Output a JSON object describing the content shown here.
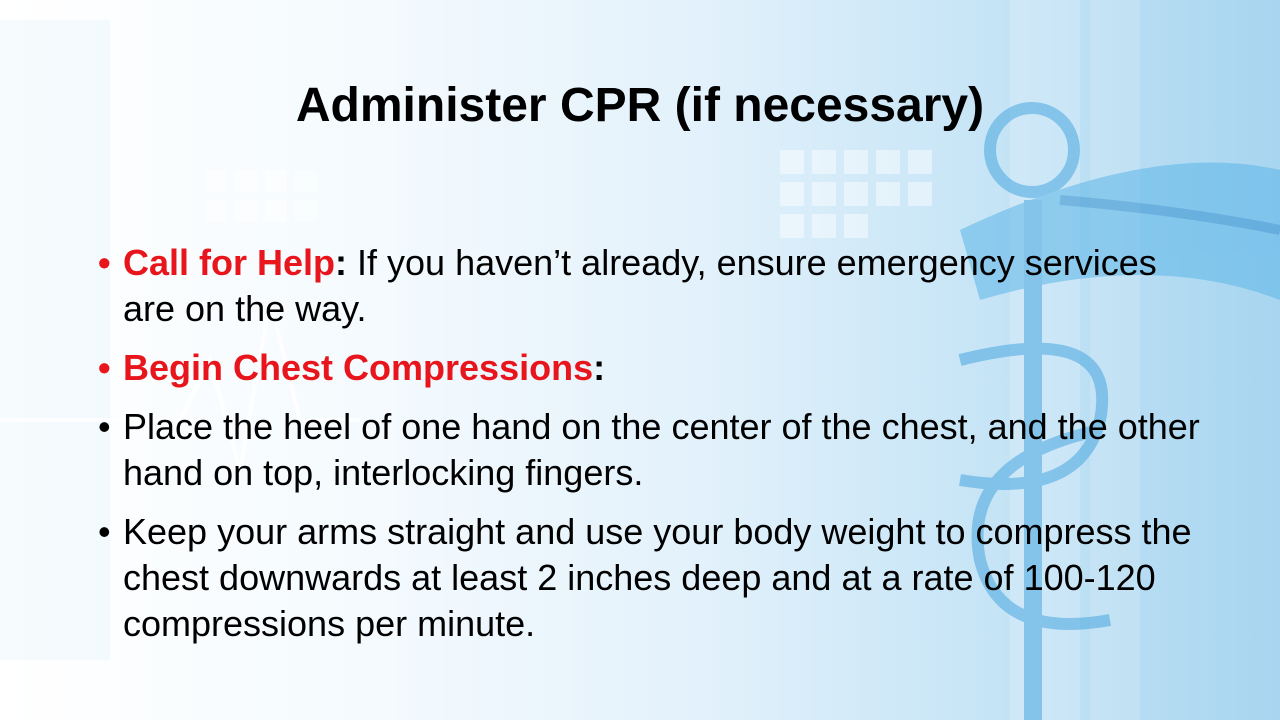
{
  "slide": {
    "title": "Administer CPR (if necessary)",
    "bullet_char": "•",
    "colors": {
      "highlight": "#e8161c",
      "text": "#000000",
      "background_accent": "#5bb4e6"
    },
    "bullets": [
      {
        "heading": "Call for Help",
        "separator": ":",
        "text": " If you haven’t already, ensure emergency services are on the way."
      },
      {
        "heading": "Begin Chest Compressions",
        "separator": ":",
        "text": ""
      },
      {
        "text": "Place the heel of one hand on the center of the chest, and the other hand on top, interlocking fingers."
      },
      {
        "text": "Keep your arms straight and use your body weight to compress the chest downwards at least 2 inches deep and at a rate of 100-120 compressions per minute."
      }
    ],
    "background_icons": [
      "caduceus-icon",
      "heartbeat-line-icon",
      "grid-squares-icon"
    ]
  }
}
